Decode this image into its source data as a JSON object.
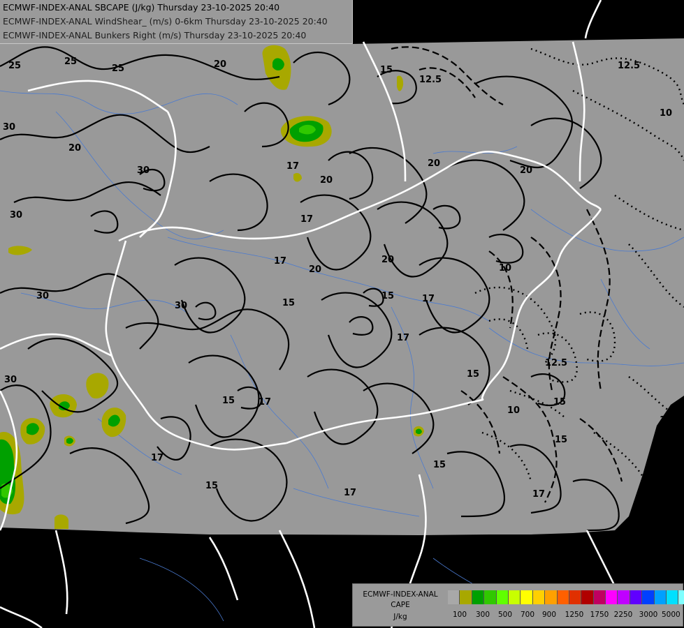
{
  "header": {
    "line1": "ECMWF-INDEX-ANAL SBCAPE (J/kg) Thursday 23-10-2025 20:40",
    "line2": "ECMWF-INDEX-ANAL WindShear_ (m/s) 0-6km Thursday 23-10-2025 20:40",
    "line3": "ECMWF-INDEX-ANAL Bunkers Right (m/s) Thursday 23-10-2025 20:40"
  },
  "legend": {
    "title_line1": "ECMWF-INDEX-ANAL",
    "title_line2": "CAPE",
    "title_line3": "J/kg",
    "colors": [
      "#a8a8a8",
      "#a8a800",
      "#00a000",
      "#30c800",
      "#60ff00",
      "#c8ff00",
      "#ffff00",
      "#ffd000",
      "#ffa000",
      "#ff6000",
      "#e03000",
      "#b00000",
      "#c00060",
      "#ff00ff",
      "#c000ff",
      "#6000ff",
      "#0040ff",
      "#00a0ff",
      "#00e0ff",
      "#80ffff",
      "#ffffff"
    ],
    "tick_labels": [
      "100",
      "300",
      "500",
      "700",
      "900",
      "1250",
      "1750",
      "2250",
      "3000",
      "5000"
    ]
  },
  "map": {
    "contour_labels": [
      "25",
      "25",
      "25",
      "30",
      "30",
      "30",
      "30",
      "30",
      "30",
      "20",
      "20",
      "20",
      "20",
      "20",
      "20",
      "20",
      "17",
      "17",
      "17",
      "17",
      "17",
      "17",
      "17",
      "17",
      "17",
      "15",
      "15",
      "15",
      "15",
      "15",
      "15",
      "15",
      "15",
      "15",
      "12.5",
      "12.5",
      "12.5",
      "10",
      "10",
      "10",
      "10"
    ]
  },
  "colors": {
    "land": "#999999",
    "outside": "#000000",
    "border": "#ffffff",
    "river": "#4a7ad0",
    "cape_low": "#a8a800",
    "cape_mid": "#30b000"
  }
}
